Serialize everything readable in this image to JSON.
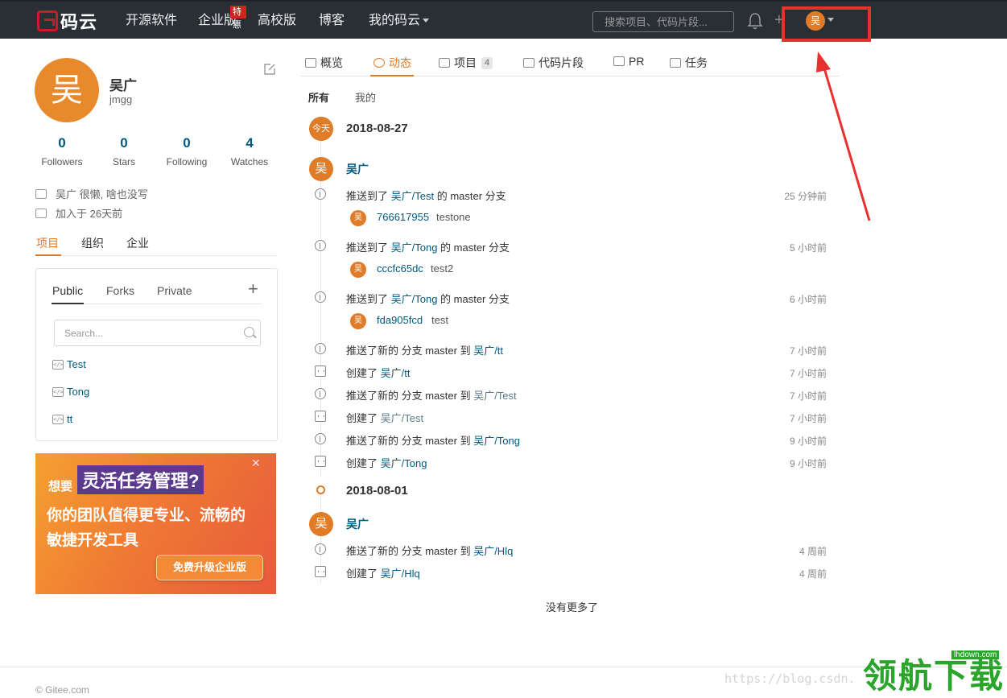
{
  "header": {
    "logo_text": "码云",
    "nav": [
      "开源软件",
      "企业版",
      "高校版",
      "博客",
      "我的码云"
    ],
    "nav_badge": "特惠",
    "search_placeholder": "搜索项目、代码片段...",
    "user_initial": "吴"
  },
  "profile": {
    "avatar_initial": "吴",
    "name": "吴广",
    "login": "jmgg",
    "stats": [
      {
        "num": "0",
        "label": "Followers"
      },
      {
        "num": "0",
        "label": "Stars"
      },
      {
        "num": "0",
        "label": "Following"
      },
      {
        "num": "4",
        "label": "Watches"
      }
    ],
    "bio": "吴广 很懒, 啥也没写",
    "joined": "加入于 26天前"
  },
  "left_tabs": [
    "项目",
    "组织",
    "企业"
  ],
  "projects": {
    "tabs": [
      "Public",
      "Forks",
      "Private"
    ],
    "add": "+",
    "search_placeholder": "Search...",
    "repos": [
      "Test",
      "Tong",
      "tt"
    ]
  },
  "promo": {
    "small": "想要",
    "title": "灵活任务管理?",
    "line1": "你的团队值得更专业、流畅的",
    "line2": "敏捷开发工具",
    "button": "免费升级企业版"
  },
  "main_tabs": [
    {
      "label": "概览"
    },
    {
      "label": "动态"
    },
    {
      "label": "项目",
      "count": "4"
    },
    {
      "label": "代码片段"
    },
    {
      "label": "PR"
    },
    {
      "label": "任务"
    }
  ],
  "filters": [
    "所有",
    "我的"
  ],
  "timeline": {
    "today": "今天",
    "dates": [
      "2018-08-27",
      "2018-08-01"
    ],
    "user_initial": "吴",
    "user_name": "吴广",
    "events": [
      {
        "pre": "推送到了 ",
        "link": "吴广/Test",
        "post": " 的 master 分支",
        "time": "25 分钟前",
        "sha": "766617955",
        "msg": "testone"
      },
      {
        "pre": "推送到了 ",
        "link": "吴广/Tong",
        "post": " 的 master 分支",
        "time": "5 小时前",
        "sha": "cccfc65dc",
        "msg": "test2"
      },
      {
        "pre": "推送到了 ",
        "link": "吴广/Tong",
        "post": " 的 master 分支",
        "time": "6 小时前",
        "sha": "fda905fcd",
        "msg": "test"
      },
      {
        "pre": "推送了新的 分支 master 到 ",
        "link": "吴广/tt",
        "post": "",
        "time": "7 小时前"
      },
      {
        "pre": "创建了 ",
        "link": "吴广/tt",
        "post": "",
        "time": "7 小时前"
      },
      {
        "pre": "推送了新的 分支 master 到 ",
        "link": "吴广/Test",
        "post": "",
        "time": "7 小时前"
      },
      {
        "pre": "创建了 ",
        "link": "吴广/Test",
        "post": "",
        "time": "7 小时前"
      },
      {
        "pre": "推送了新的 分支 master 到 ",
        "link": "吴广/Tong",
        "post": "",
        "time": "9 小时前"
      },
      {
        "pre": "创建了 ",
        "link": "吴广/Tong",
        "post": "",
        "time": "9 小时前"
      },
      {
        "pre": "推送了新的 分支 master 到 ",
        "link": "吴广/Hlq",
        "post": "",
        "time": "4 周前"
      },
      {
        "pre": "创建了 ",
        "link": "吴广/Hlq",
        "post": "",
        "time": "4 周前"
      }
    ],
    "no_more": "没有更多了"
  },
  "footer": {
    "copyright": "© Gitee.com"
  },
  "watermark": {
    "url": "https://blog.csdn.",
    "logo": "领航下载",
    "small": "lhdown.com"
  },
  "colors": {
    "accent": "#e07b27",
    "link": "#005980",
    "header_bg": "#2a2e35",
    "highlight_box": "#e8302f"
  }
}
